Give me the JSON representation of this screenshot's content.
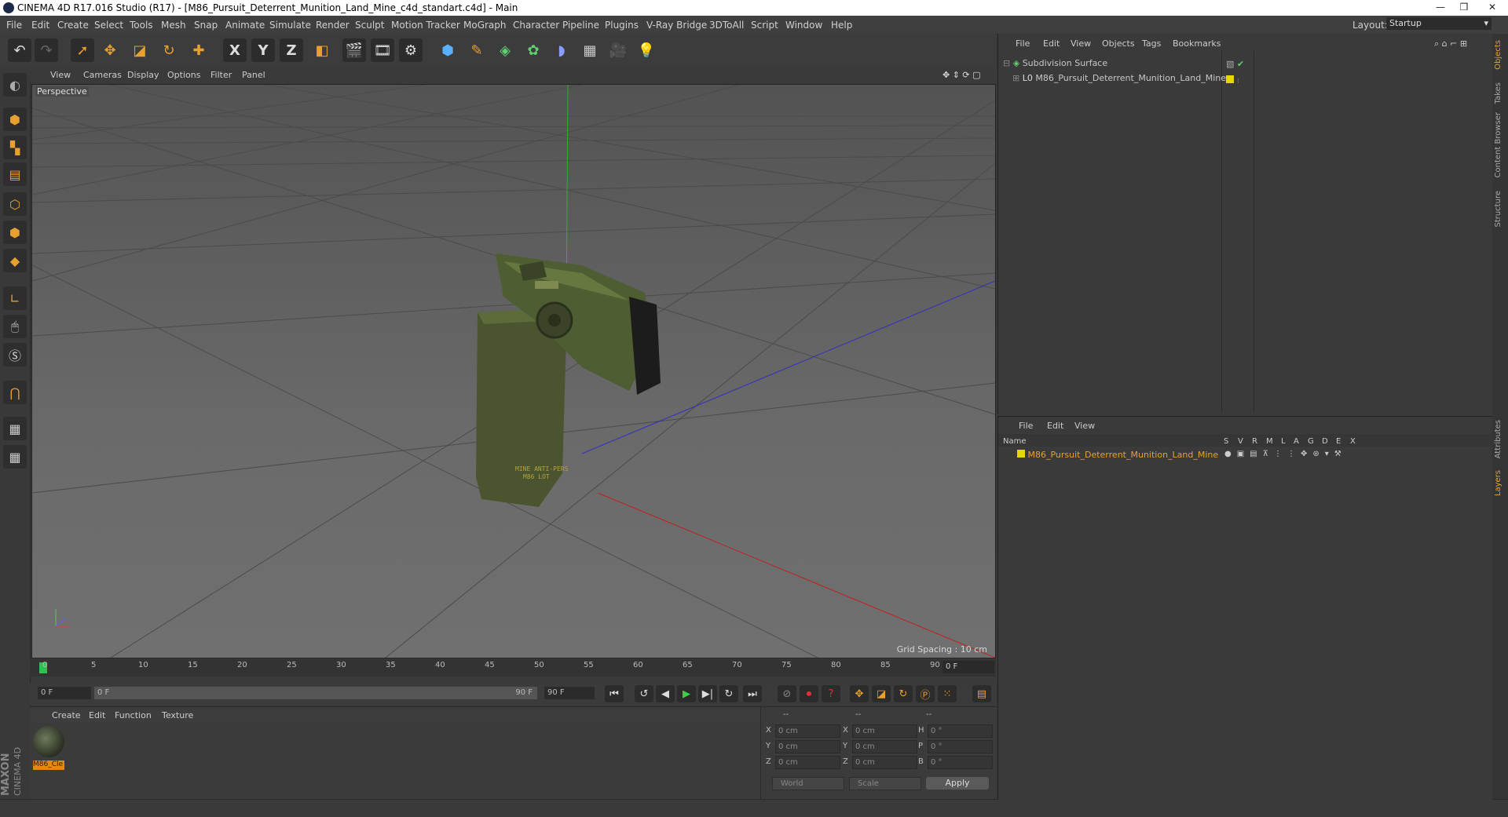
{
  "window": {
    "title": "CINEMA 4D R17.016 Studio (R17) - [M86_Pursuit_Deterrent_Munition_Land_Mine_c4d_standart.c4d] - Main",
    "controls": [
      "—",
      "❒",
      "✕"
    ]
  },
  "menubar": {
    "items": [
      "File",
      "Edit",
      "Create",
      "Select",
      "Tools",
      "Mesh",
      "Snap",
      "Animate",
      "Simulate",
      "Render",
      "Sculpt",
      "Motion Tracker",
      "MoGraph",
      "Character",
      "Pipeline",
      "Plugins",
      "V-Ray Bridge",
      "3DToAll",
      "Script",
      "Window",
      "Help"
    ],
    "layout_label": "Layout:",
    "layout_value": "Startup"
  },
  "toolbar": {
    "axis_labels": [
      "X",
      "Y",
      "Z"
    ],
    "icons": [
      "undo-icon",
      "redo-icon",
      "select-icon",
      "move-icon",
      "scale-icon",
      "rotate-icon",
      "move-all-icon",
      "x-axis-icon",
      "y-axis-icon",
      "z-axis-icon",
      "coord-system-icon",
      "render-view-icon",
      "render-picture-icon",
      "render-settings-icon",
      "cube-icon",
      "pen-icon",
      "subdivision-icon",
      "mograph-icon",
      "deformer-icon",
      "floor-icon",
      "camera-icon",
      "light-icon"
    ]
  },
  "viewport": {
    "menu": [
      "View",
      "Cameras",
      "Display",
      "Options",
      "Filter",
      "Panel"
    ],
    "label": "Perspective",
    "grid_spacing": "Grid Spacing : 10 cm",
    "model_text_line1": "MINE ANTI-PERS",
    "model_text_line2": "M86 LOT"
  },
  "timeline": {
    "ticks": [
      "0",
      "5",
      "10",
      "15",
      "20",
      "25",
      "30",
      "35",
      "40",
      "45",
      "50",
      "55",
      "60",
      "65",
      "70",
      "75",
      "80",
      "85",
      "90"
    ],
    "current_frame": "0 F"
  },
  "playbar": {
    "start_field": "0 F",
    "range_start": "0 F",
    "range_end": "90 F",
    "end_field": "90 F"
  },
  "material_panel": {
    "menu": [
      "Create",
      "Edit",
      "Function",
      "Texture"
    ],
    "material_name": "M86_Cle"
  },
  "coord_panel": {
    "headers": [
      "--",
      "--",
      "--"
    ],
    "rows": [
      {
        "a": "X",
        "av": "0 cm",
        "b": "X",
        "bv": "0 cm",
        "c": "H",
        "cv": "0 °"
      },
      {
        "a": "Y",
        "av": "0 cm",
        "b": "Y",
        "bv": "0 cm",
        "c": "P",
        "cv": "0 °"
      },
      {
        "a": "Z",
        "av": "0 cm",
        "b": "Z",
        "bv": "0 cm",
        "c": "B",
        "cv": "0 °"
      }
    ],
    "mode": "World",
    "transform": "Scale",
    "apply_label": "Apply"
  },
  "object_manager": {
    "menu": [
      "File",
      "Edit",
      "View",
      "Objects",
      "Tags",
      "Bookmarks"
    ],
    "objects": [
      {
        "name": "Subdivision Surface"
      },
      {
        "name": "M86_Pursuit_Deterrent_Munition_Land_Mine"
      }
    ]
  },
  "layer_manager": {
    "menu": [
      "File",
      "Edit",
      "View"
    ],
    "name_header": "Name",
    "columns": [
      "S",
      "V",
      "R",
      "M",
      "L",
      "A",
      "G",
      "D",
      "E",
      "X"
    ],
    "layer_name": "M86_Pursuit_Deterrent_Munition_Land_Mine"
  },
  "side_tabs": [
    "Objects",
    "Takes",
    "Content Browser",
    "Structure",
    "Attributes",
    "Layers"
  ],
  "branding": {
    "line1": "MAXON",
    "line2": "CINEMA 4D"
  },
  "colors": {
    "accent": "#e8a030",
    "layer_text": "#e8a030",
    "yellow_layer": "#e4d800"
  }
}
